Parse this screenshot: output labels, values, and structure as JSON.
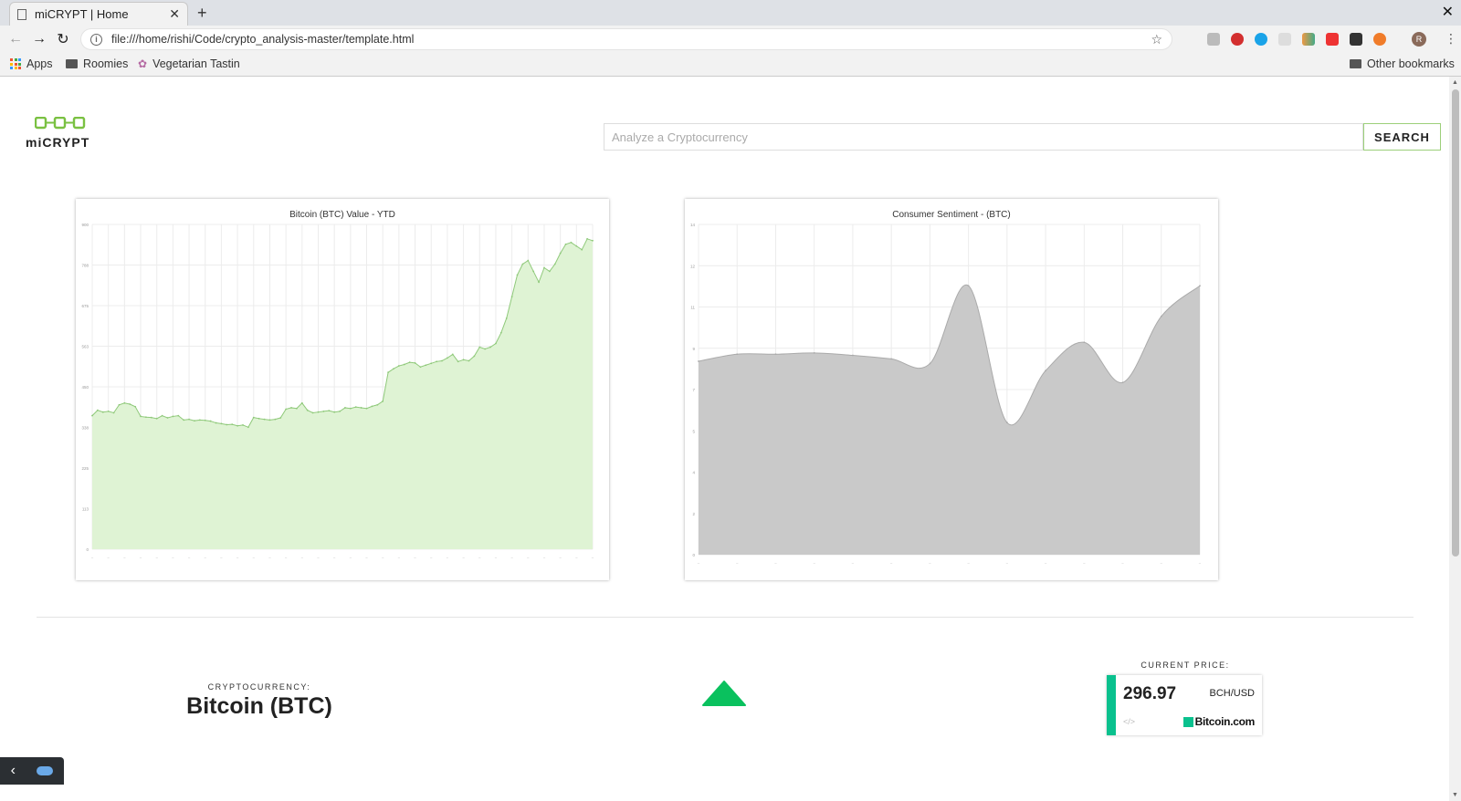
{
  "browser": {
    "tab_title": "miCRYPT | Home",
    "url": "file:///home/rishi/Code/crypto_analysis-master/template.html",
    "bookmarks": {
      "apps": "Apps",
      "roomies": "Roomies",
      "vegetarian": "Vegetarian Tastin",
      "other": "Other bookmarks"
    },
    "profile_initial": "R"
  },
  "header": {
    "brand": "miCRYPT",
    "search_placeholder": "Analyze a Cryptocurrency",
    "search_button": "SEARCH"
  },
  "charts": [
    {
      "title": "Bitcoin (BTC) Value - YTD",
      "type": "area",
      "fill": "#dff3d4",
      "stroke": "#8fc97a",
      "ylim": [
        0,
        900
      ]
    },
    {
      "title": "Consumer Sentiment - (BTC)",
      "type": "area",
      "fill": "#c9c9c9",
      "stroke": "#aaaaaa",
      "ylim": [
        0,
        14
      ]
    }
  ],
  "chart_data": [
    {
      "type": "area",
      "title": "Bitcoin (BTC) Value - YTD",
      "ylim": [
        0,
        900
      ],
      "values": [
        370,
        385,
        380,
        382,
        378,
        400,
        405,
        402,
        395,
        368,
        366,
        365,
        362,
        370,
        364,
        368,
        370,
        358,
        360,
        356,
        358,
        357,
        355,
        350,
        348,
        345,
        346,
        342,
        344,
        338,
        365,
        362,
        360,
        358,
        360,
        364,
        388,
        392,
        390,
        405,
        385,
        378,
        380,
        382,
        384,
        380,
        382,
        392,
        390,
        394,
        392,
        390,
        396,
        400,
        410,
        490,
        500,
        508,
        512,
        518,
        516,
        505,
        510,
        515,
        520,
        522,
        530,
        540,
        520,
        525,
        522,
        535,
        560,
        555,
        560,
        570,
        600,
        640,
        700,
        760,
        790,
        800,
        770,
        740,
        780,
        770,
        790,
        820,
        845,
        850,
        840,
        830,
        860,
        855
      ]
    },
    {
      "type": "area",
      "title": "Consumer Sentiment - (BTC)",
      "ylim": [
        0,
        14
      ],
      "values": [
        8.2,
        8.5,
        8.5,
        8.55,
        8.45,
        8.3,
        8.1,
        11.4,
        5.6,
        7.8,
        9.0,
        7.3,
        10.1,
        11.4
      ]
    }
  ],
  "main": {
    "crypto_label": "CRYPTOCURRENCY:",
    "crypto_name": "Bitcoin (BTC)",
    "trend": "up",
    "price_label": "CURRENT PRICE:",
    "price": "296.97",
    "pair": "BCH/USD",
    "code_glyph": "</>",
    "widget_brand": "Bitcoin.com",
    "accent": "#0ac18e"
  }
}
